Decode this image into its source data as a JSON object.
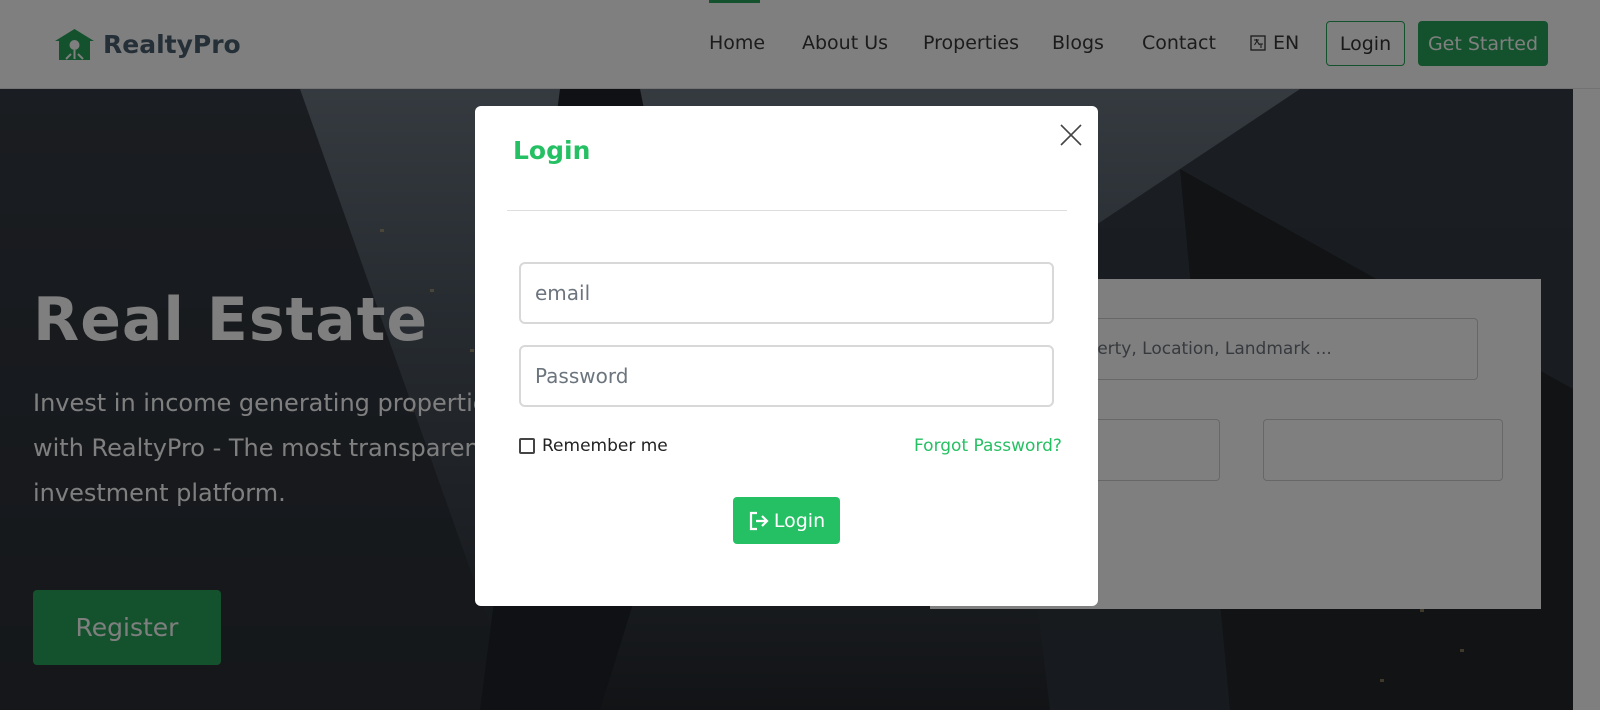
{
  "brand": {
    "name": "RealtyPro",
    "color": "#26a55a"
  },
  "nav": {
    "items": [
      {
        "label": "Home",
        "active": true
      },
      {
        "label": "About Us"
      },
      {
        "label": "Properties"
      },
      {
        "label": "Blogs"
      },
      {
        "label": "Contact"
      }
    ],
    "language": "EN",
    "login_label": "Login",
    "get_started_label": "Get Started"
  },
  "hero": {
    "title": "Real Estate",
    "subtitle": "Invest in income generating properties i with RealtyPro - The most transparent investment platform.",
    "register_label": "Register",
    "search_placeholder": "operty, Location, Landmark ..."
  },
  "modal": {
    "title": "Login",
    "email_placeholder": "email",
    "password_placeholder": "Password",
    "remember_label": "Remember me",
    "forgot_label": "Forgot Password?",
    "submit_label": "Login",
    "icons": {
      "close": "close-icon",
      "submit": "sign-in-icon"
    }
  }
}
